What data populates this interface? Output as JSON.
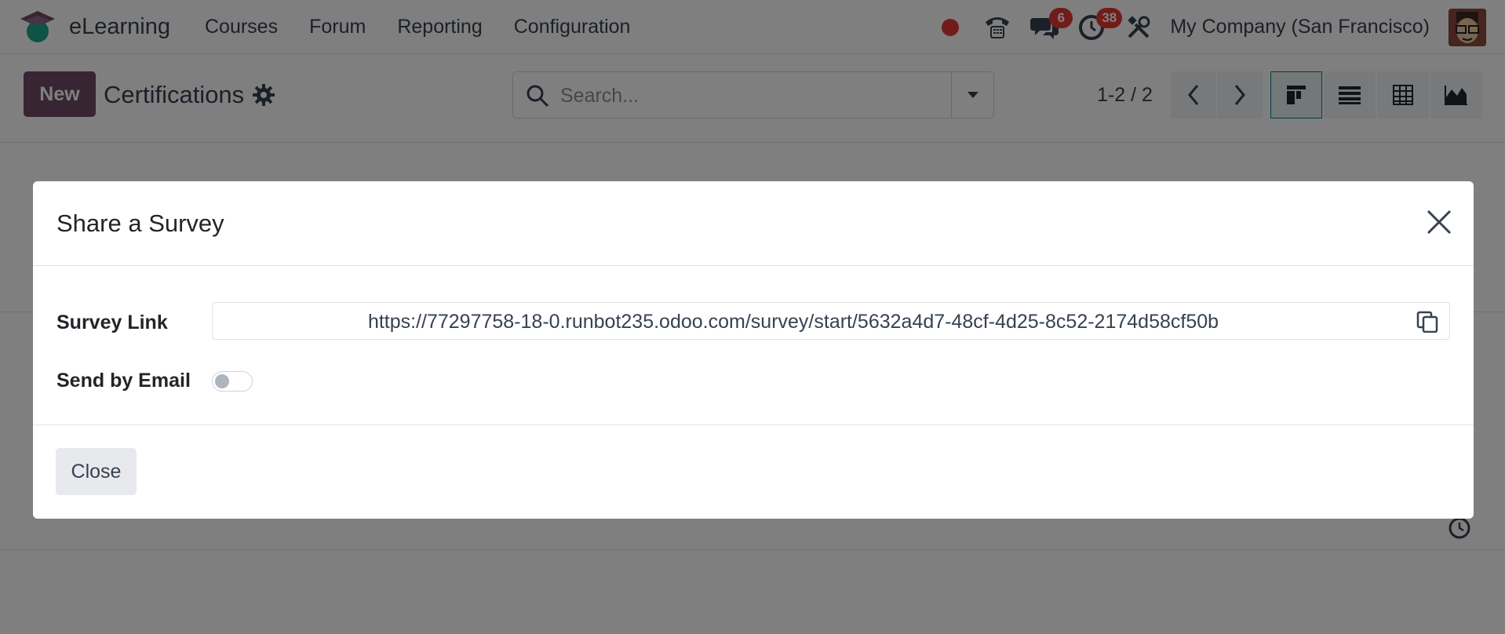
{
  "app": {
    "name": "eLearning",
    "menu": [
      "Courses",
      "Forum",
      "Reporting",
      "Configuration"
    ],
    "messages_count": "6",
    "activities_count": "38",
    "company": "My Company (San Francisco)"
  },
  "control_panel": {
    "new_label": "New",
    "title": "Certifications",
    "search_placeholder": "Search...",
    "pager": "1-2 / 2"
  },
  "dialog": {
    "title": "Share a Survey",
    "survey_link_label": "Survey Link",
    "survey_link": "https://77297758-18-0.runbot235.odoo.com/survey/start/5632a4d7-48cf-4d25-8c52-2174d58cf50b",
    "send_by_email_label": "Send by Email",
    "send_by_email_enabled": false,
    "close_label": "Close"
  },
  "colors": {
    "brand": "#714b67",
    "accent": "#017e84",
    "badge": "#e53935"
  }
}
